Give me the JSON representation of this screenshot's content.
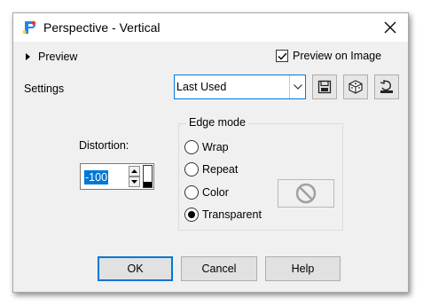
{
  "window": {
    "title": "Perspective - Vertical"
  },
  "header": {
    "preview_label": "Preview",
    "preview_on_image_label": "Preview on Image",
    "preview_on_image_checked": true
  },
  "settings": {
    "label": "Settings",
    "preset_value": "Last Used"
  },
  "distortion": {
    "label": "Distortion:",
    "value": "-100"
  },
  "edge_mode": {
    "legend": "Edge mode",
    "options": [
      {
        "label": "Wrap",
        "selected": false
      },
      {
        "label": "Repeat",
        "selected": false
      },
      {
        "label": "Color",
        "selected": false
      },
      {
        "label": "Transparent",
        "selected": true
      }
    ]
  },
  "buttons": {
    "ok": "OK",
    "cancel": "Cancel",
    "help": "Help"
  },
  "colors": {
    "accent": "#0078d7",
    "dialog_bg": "#f0f0f0"
  },
  "icons": [
    "app-icon",
    "close-icon",
    "expand-triangle-icon",
    "check-icon",
    "dropdown-arrow-icon",
    "save-preset-icon",
    "randomize-icon",
    "reset-icon",
    "no-color-icon"
  ]
}
